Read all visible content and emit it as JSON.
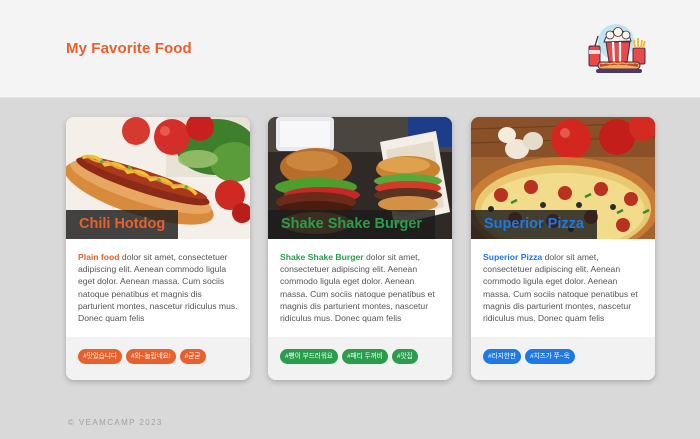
{
  "header": {
    "title": "My Favorite Food"
  },
  "colors": {
    "hotdog": "#e8612c",
    "burger": "#2a9d4c",
    "pizza": "#1e78e6"
  },
  "cards": [
    {
      "name": "Chili Hotdog",
      "lead": "Plain food",
      "body": " dolor sit amet, consectetuer adipiscing elit. Aenean commodo ligula eget dolor. Aenean massa. Cum sociis natoque penatibus et magnis dis parturient montes, nascetur ridiculus mus. Donec quam felis",
      "tags": [
        "#맛있습니다",
        "#와~놀랍네요!",
        "#굳굳"
      ]
    },
    {
      "name": "Shake Shake Burger",
      "lead": "Shake Shake Burger",
      "body": " dolor sit amet, consectetuer adipiscing elit. Aenean commodo ligula eget dolor. Aenean massa. Cum sociis natoque penatibus et magnis dis parturient montes, nascetur ridiculus mus. Donec quam felis",
      "tags": [
        "#빵이 부드러워요",
        "#패티 두꺼비",
        "#맛집"
      ]
    },
    {
      "name": "Superior Pizza",
      "lead": "Superior Pizza",
      "body": " dolor sit amet, consectetuer adipiscing elit. Aenean commodo ligula eget dolor. Aenean massa. Cum sociis natoque penatibus et magnis dis parturient montes, nascetur ridiculus mus. Donec quam felis",
      "tags": [
        "#라지한판",
        "#치즈가 쭈~욱"
      ]
    }
  ],
  "footer": {
    "text": "© VEAMCAMP 2023"
  }
}
